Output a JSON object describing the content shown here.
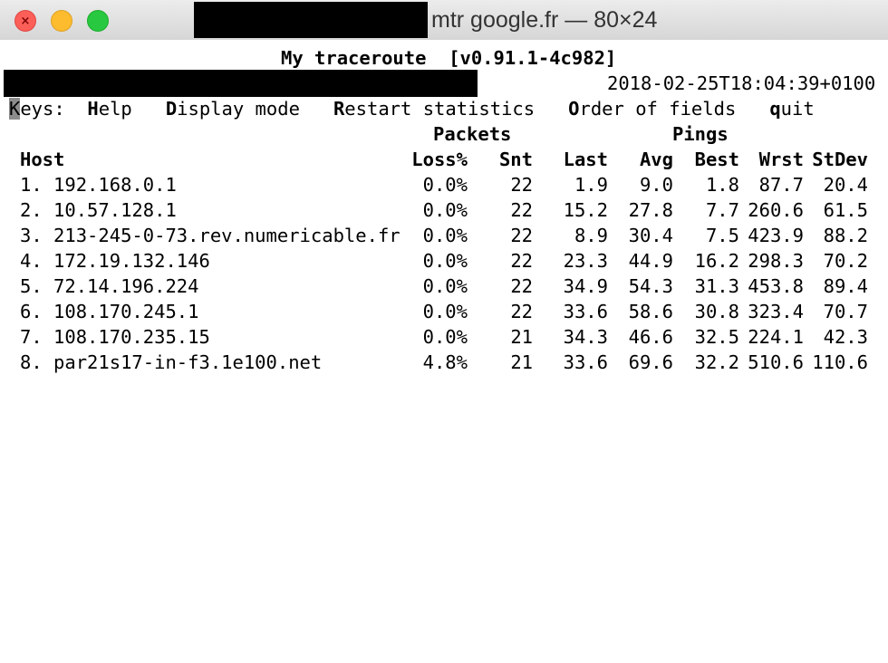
{
  "window": {
    "title": "mtr google.fr — 80×24",
    "close_glyph": "×"
  },
  "mtr": {
    "heading": "My traceroute  [v0.91.1-4c982]",
    "timestamp": "2018-02-25T18:04:39+0100",
    "keys": {
      "cursor": "K",
      "label": "eys:",
      "help_key": "H",
      "help_rest": "elp",
      "display_key": "D",
      "display_rest": "isplay mode",
      "restart_key": "R",
      "restart_rest": "estart statistics",
      "order_key": "O",
      "order_rest": "rder of fields",
      "quit_key": "q",
      "quit_rest": "uit"
    },
    "groups": {
      "packets": "Packets",
      "pings": "Pings"
    },
    "columns": {
      "host": "Host",
      "loss": "Loss%",
      "snt": "Snt",
      "last": "Last",
      "avg": "Avg",
      "best": "Best",
      "wrst": "Wrst",
      "stdev": "StDev"
    },
    "hops": [
      {
        "host": "1. 192.168.0.1",
        "loss": "0.0%",
        "snt": "22",
        "last": "1.9",
        "avg": "9.0",
        "best": "1.8",
        "wrst": "87.7",
        "stdev": "20.4"
      },
      {
        "host": "2. 10.57.128.1",
        "loss": "0.0%",
        "snt": "22",
        "last": "15.2",
        "avg": "27.8",
        "best": "7.7",
        "wrst": "260.6",
        "stdev": "61.5"
      },
      {
        "host": "3. 213-245-0-73.rev.numericable.fr",
        "loss": "0.0%",
        "snt": "22",
        "last": "8.9",
        "avg": "30.4",
        "best": "7.5",
        "wrst": "423.9",
        "stdev": "88.2"
      },
      {
        "host": "4. 172.19.132.146",
        "loss": "0.0%",
        "snt": "22",
        "last": "23.3",
        "avg": "44.9",
        "best": "16.2",
        "wrst": "298.3",
        "stdev": "70.2"
      },
      {
        "host": "5. 72.14.196.224",
        "loss": "0.0%",
        "snt": "22",
        "last": "34.9",
        "avg": "54.3",
        "best": "31.3",
        "wrst": "453.8",
        "stdev": "89.4"
      },
      {
        "host": "6. 108.170.245.1",
        "loss": "0.0%",
        "snt": "22",
        "last": "33.6",
        "avg": "58.6",
        "best": "30.8",
        "wrst": "323.4",
        "stdev": "70.7"
      },
      {
        "host": "7. 108.170.235.15",
        "loss": "0.0%",
        "snt": "21",
        "last": "34.3",
        "avg": "46.6",
        "best": "32.5",
        "wrst": "224.1",
        "stdev": "42.3"
      },
      {
        "host": "8. par21s17-in-f3.1e100.net",
        "loss": "4.8%",
        "snt": "21",
        "last": "33.6",
        "avg": "69.6",
        "best": "32.2",
        "wrst": "510.6",
        "stdev": "110.6"
      }
    ]
  }
}
